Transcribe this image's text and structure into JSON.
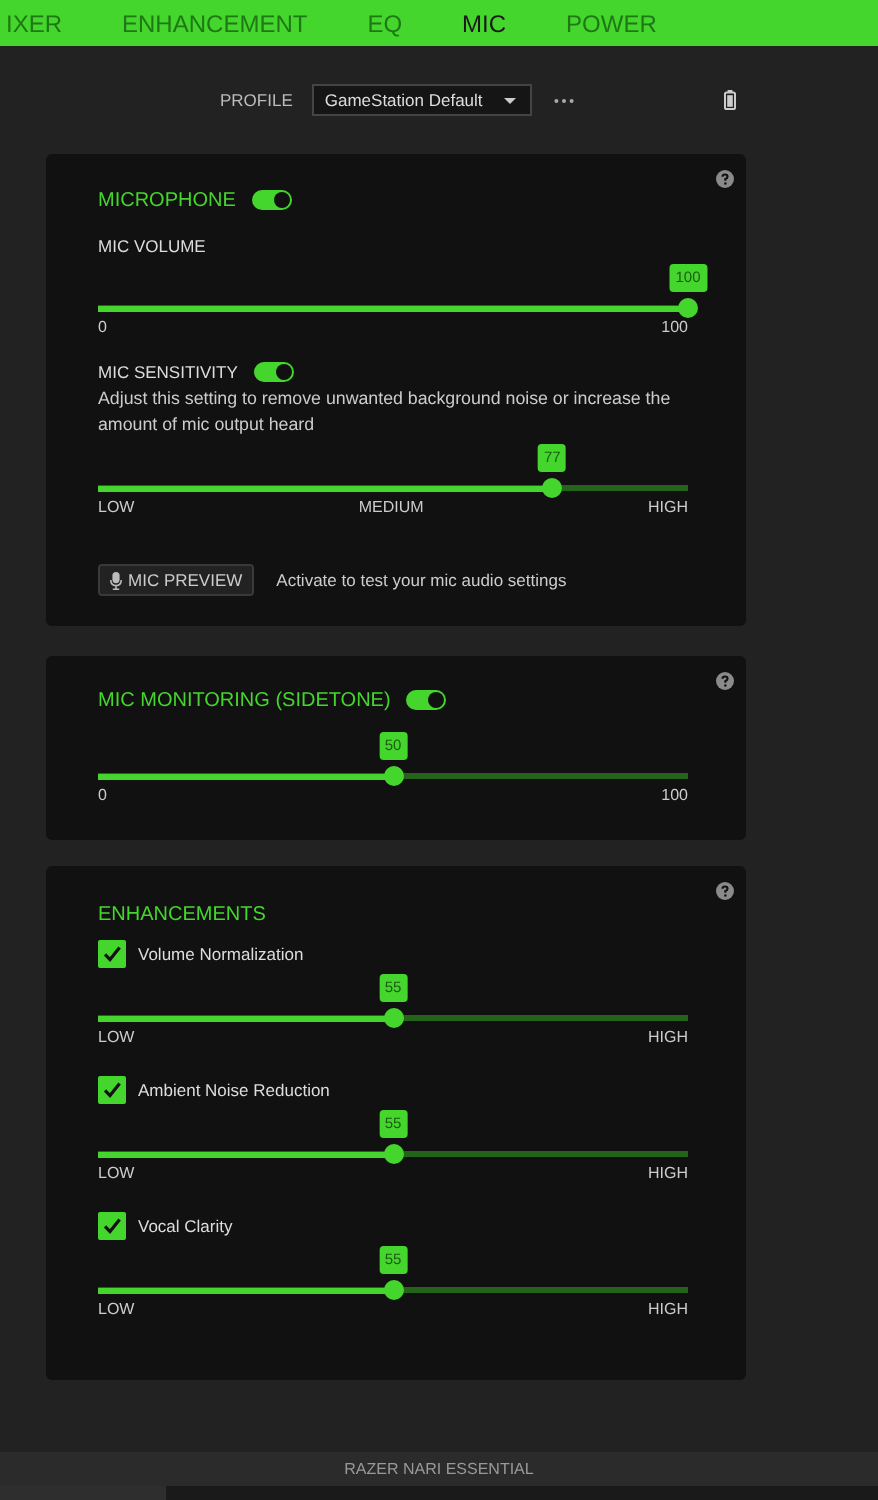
{
  "tabs": [
    {
      "label": "IXER",
      "selected": false
    },
    {
      "label": "ENHANCEMENT",
      "selected": false
    },
    {
      "label": "EQ",
      "selected": false
    },
    {
      "label": "MIC",
      "selected": true
    },
    {
      "label": "POWER",
      "selected": false
    }
  ],
  "profile": {
    "label": "PROFILE",
    "value": "GameStation Default"
  },
  "microphone": {
    "title": "MICROPHONE",
    "on": true,
    "volume": {
      "label": "MIC VOLUME",
      "slider": {
        "badge": "100",
        "level": 1,
        "labels": [
          "0",
          "100"
        ]
      }
    },
    "sensitivity": {
      "label": "MIC SENSITIVITY",
      "on": true,
      "description": "Adjust this setting to remove unwanted background noise or increase the amount of mic output heard",
      "slider": {
        "badge": "77",
        "level": 0.77,
        "labels": [
          "LOW",
          "MEDIUM",
          "HIGH"
        ]
      }
    },
    "preview": {
      "button": "MIC PREVIEW",
      "hint": "Activate to test your mic audio settings"
    }
  },
  "monitoring": {
    "title": "MIC MONITORING (SIDETONE)",
    "on": true,
    "slider": {
      "badge": "50",
      "level": 0.5,
      "labels": [
        "0",
        "100"
      ]
    }
  },
  "enhancements": {
    "title": "ENHANCEMENTS",
    "items": [
      {
        "label": "Volume Normalization",
        "checked": true,
        "slider": {
          "badge": "55",
          "level": 0.5,
          "labels": [
            "LOW",
            "HIGH"
          ]
        }
      },
      {
        "label": "Ambient Noise Reduction",
        "checked": true,
        "slider": {
          "badge": "55",
          "level": 0.5,
          "labels": [
            "LOW",
            "HIGH"
          ]
        }
      },
      {
        "label": "Vocal Clarity",
        "checked": true,
        "slider": {
          "badge": "55",
          "level": 0.5,
          "labels": [
            "LOW",
            "HIGH"
          ]
        }
      }
    ]
  },
  "device_bar": {
    "label": "RAZER NARI ESSENTIAL"
  }
}
